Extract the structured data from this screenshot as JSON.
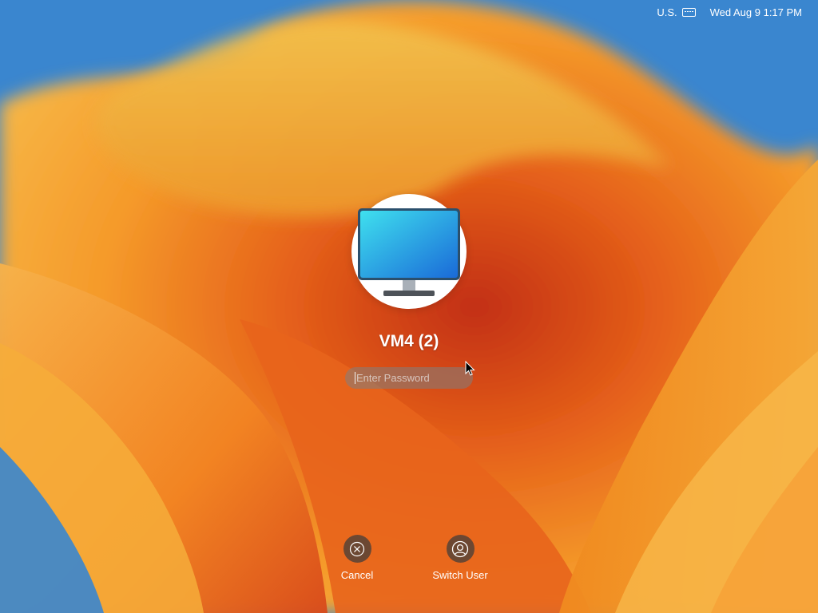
{
  "menubar": {
    "input_source": "U.S.",
    "input_source_icon": "keyboard-icon",
    "datetime": "Wed Aug 9 1:17 PM"
  },
  "login": {
    "avatar_icon": "monitor-icon",
    "user_name": "VM4 (2)",
    "password_placeholder": "Enter Password",
    "password_value": ""
  },
  "actions": {
    "cancel_label": "Cancel",
    "cancel_icon": "close-circle-icon",
    "switch_user_label": "Switch User",
    "switch_user_icon": "user-circle-icon"
  },
  "colors": {
    "wallpaper_blue": "#2f7fc9",
    "wallpaper_orange": "#f08a1e",
    "wallpaper_red": "#c93a14",
    "wallpaper_yellow": "#f5b640"
  }
}
